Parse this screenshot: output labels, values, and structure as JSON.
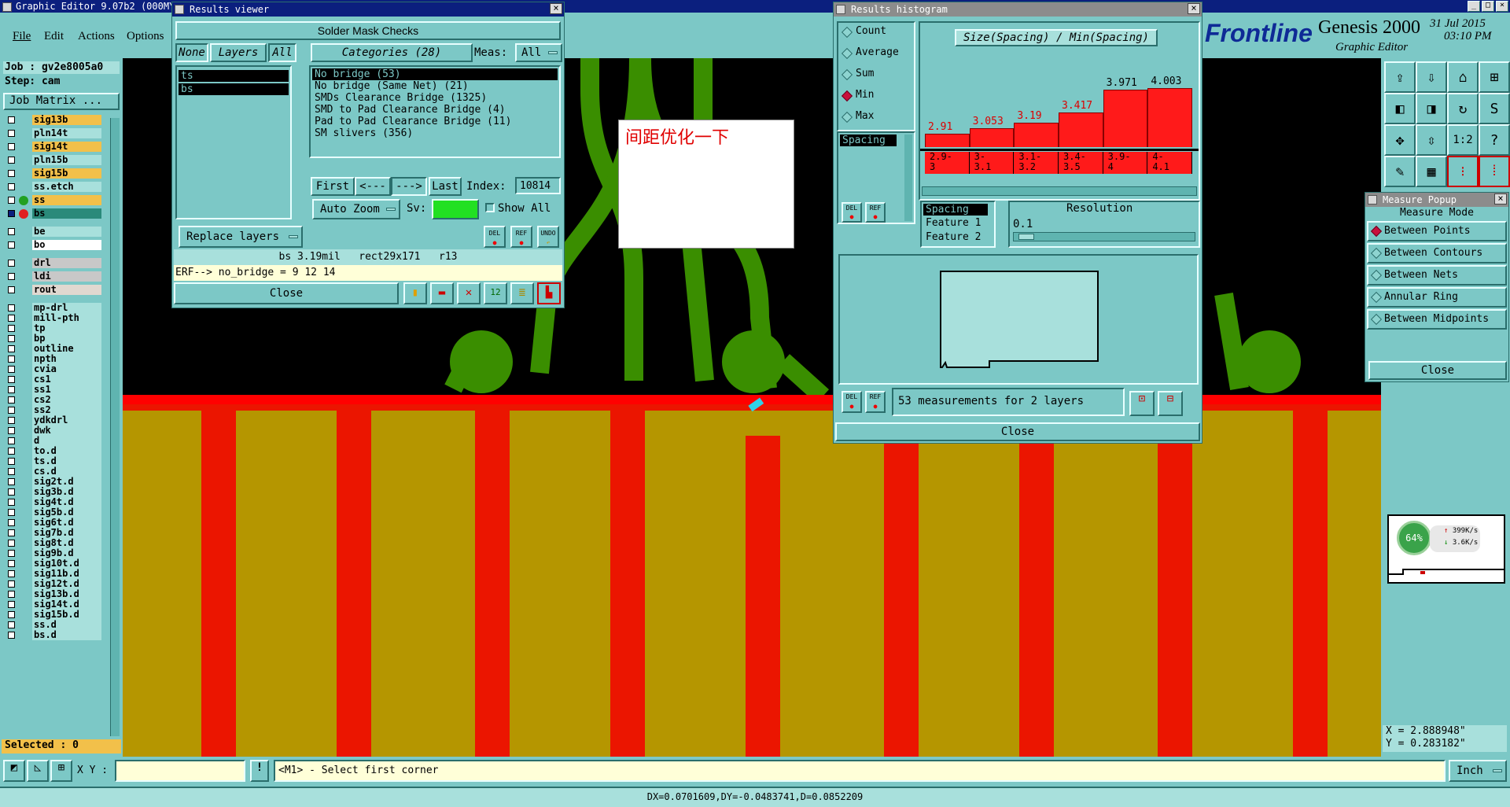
{
  "app": {
    "title": "Graphic Editor 9.07b2 (000MY",
    "window_buttons": [
      "_",
      "□",
      "×"
    ]
  },
  "menu": [
    "File",
    "Edit",
    "Actions",
    "Options"
  ],
  "brand": {
    "logo": "Frontline",
    "product": "Genesis 2000",
    "subtitle": "Graphic Editor",
    "date": "31 Jul 2015",
    "time": "03:10 PM"
  },
  "job": {
    "job": "Job : gv2e8005a0",
    "step": "Step: cam",
    "matrix_button": "Job Matrix ..."
  },
  "layers": [
    {
      "name": "sig13b",
      "bg": "#f2c04a"
    },
    {
      "name": "pln14t",
      "bg": "#a8e0dc"
    },
    {
      "name": "sig14t",
      "bg": "#f2c04a"
    },
    {
      "name": "pln15b",
      "bg": "#a8e0dc"
    },
    {
      "name": "sig15b",
      "bg": "#f2c04a"
    },
    {
      "name": "ss.etch",
      "bg": "#a8e0dc"
    },
    {
      "name": "ss",
      "bg": "#f2c04a",
      "dot": "#22a022"
    },
    {
      "name": "bs",
      "bg": "#2a8a7a",
      "dot": "#e02020",
      "sel": true
    },
    {
      "name": "be",
      "bg": "#a8e0dc"
    },
    {
      "name": "bo",
      "bg": "#ffffff"
    },
    {
      "name": "drl",
      "bg": "#c8c8c8"
    },
    {
      "name": "ldi",
      "bg": "#c8c8c8"
    },
    {
      "name": "rout",
      "bg": "#e0d8d0"
    },
    {
      "name": "mp-drl",
      "bg": "#a8e0dc"
    },
    {
      "name": "mill-pth",
      "bg": "#a8e0dc"
    },
    {
      "name": "tp",
      "bg": "#a8e0dc"
    },
    {
      "name": "bp",
      "bg": "#a8e0dc"
    },
    {
      "name": "outline",
      "bg": "#a8e0dc"
    },
    {
      "name": "npth",
      "bg": "#a8e0dc"
    },
    {
      "name": "cvia",
      "bg": "#a8e0dc"
    },
    {
      "name": "cs1",
      "bg": "#a8e0dc"
    },
    {
      "name": "ss1",
      "bg": "#a8e0dc"
    },
    {
      "name": "cs2",
      "bg": "#a8e0dc"
    },
    {
      "name": "ss2",
      "bg": "#a8e0dc"
    },
    {
      "name": "ydkdrl",
      "bg": "#a8e0dc"
    },
    {
      "name": "dwk",
      "bg": "#a8e0dc"
    },
    {
      "name": "d",
      "bg": "#a8e0dc"
    },
    {
      "name": "to.d",
      "bg": "#a8e0dc"
    },
    {
      "name": "ts.d",
      "bg": "#a8e0dc"
    },
    {
      "name": "cs.d",
      "bg": "#a8e0dc"
    },
    {
      "name": "sig2t.d",
      "bg": "#a8e0dc"
    },
    {
      "name": "sig3b.d",
      "bg": "#a8e0dc"
    },
    {
      "name": "sig4t.d",
      "bg": "#a8e0dc"
    },
    {
      "name": "sig5b.d",
      "bg": "#a8e0dc"
    },
    {
      "name": "sig6t.d",
      "bg": "#a8e0dc"
    },
    {
      "name": "sig7b.d",
      "bg": "#a8e0dc"
    },
    {
      "name": "sig8t.d",
      "bg": "#a8e0dc"
    },
    {
      "name": "sig9b.d",
      "bg": "#a8e0dc"
    },
    {
      "name": "sig10t.d",
      "bg": "#a8e0dc"
    },
    {
      "name": "sig11b.d",
      "bg": "#a8e0dc"
    },
    {
      "name": "sig12t.d",
      "bg": "#a8e0dc"
    },
    {
      "name": "sig13b.d",
      "bg": "#a8e0dc"
    },
    {
      "name": "sig14t.d",
      "bg": "#a8e0dc"
    },
    {
      "name": "sig15b.d",
      "bg": "#a8e0dc"
    },
    {
      "name": "ss.d",
      "bg": "#a8e0dc"
    },
    {
      "name": "bs.d",
      "bg": "#a8e0dc"
    }
  ],
  "selected": "Selected : 0",
  "results_viewer": {
    "title": "Results viewer",
    "heading": "Solder Mask Checks",
    "none": "None",
    "layers": "Layers",
    "all": "All",
    "categories": "Categories (28)",
    "meas_label": "Meas:",
    "meas_value": "All",
    "layer_list": [
      "ts",
      "bs"
    ],
    "cat_list": [
      "No bridge (53)",
      "No bridge (Same Net) (21)",
      "SMDs Clearance Bridge (1325)",
      "SMD to Pad Clearance Bridge (4)",
      "Pad to Pad Clearance Bridge (11)",
      "SM slivers (356)"
    ],
    "first": "First",
    "prev": "<---",
    "next": "--->",
    "last": "Last",
    "index_label": "Index:",
    "index_value": "10814",
    "auto_zoom": "Auto Zoom",
    "sv": "Sv:",
    "show_all": "Show All",
    "replace_layers": "Replace layers",
    "del": "DEL",
    "ref": "REF",
    "undo": "UNDO",
    "info": "bs 3.19mil   rect29x171   r13",
    "erf": "ERF--> no_bridge = 9 12 14",
    "close": "Close"
  },
  "note": "间距优化一下",
  "histogram": {
    "title": "Results histogram",
    "options": [
      {
        "label": "Count",
        "on": false
      },
      {
        "label": "Average",
        "on": false
      },
      {
        "label": "Sum",
        "on": false
      },
      {
        "label": "Min",
        "on": true
      },
      {
        "label": "Max",
        "on": false
      }
    ],
    "chart_title": "Size(Spacing) / Min(Spacing)",
    "list_item": "Spacing",
    "bars": [
      {
        "label": "2.91",
        "value": 2.91,
        "bin": "2.9-\n3",
        "red": true
      },
      {
        "label": "3.053",
        "value": 3.053,
        "bin": "3-\n3.1",
        "red": true
      },
      {
        "label": "3.19",
        "value": 3.19,
        "bin": "3.1-\n3.2",
        "red": true
      },
      {
        "label": "3.417",
        "value": 3.417,
        "bin": "3.4-\n3.5",
        "red": true
      },
      {
        "label": "3.971",
        "value": 3.971,
        "bin": "3.9-\n4",
        "red": false
      },
      {
        "label": "4.003",
        "value": 4.003,
        "bin": "4-\n4.1",
        "red": false
      }
    ],
    "features": [
      "Spacing",
      "Feature 1",
      "Feature 2"
    ],
    "resolution_label": "Resolution",
    "resolution_value": "0.1",
    "del": "DEL",
    "ref": "REF",
    "status": "53 measurements for 2 layers",
    "close": "Close"
  },
  "measure": {
    "title": "Measure Popup",
    "heading": "Measure Mode",
    "modes": [
      {
        "label": "Between Points",
        "on": true
      },
      {
        "label": "Between Contours",
        "on": false
      },
      {
        "label": "Between Nets",
        "on": false
      },
      {
        "label": "Annular Ring",
        "on": false
      },
      {
        "label": "Between Midpoints",
        "on": false
      }
    ],
    "close": "Close"
  },
  "netmon": {
    "percent": "64%",
    "up": "399K/s",
    "down": "3.6K/s"
  },
  "coords": {
    "x": "X = 2.888948\"",
    "y": "Y = 0.283182\""
  },
  "bottom": {
    "xy_label": "X Y :",
    "xy_value": "",
    "prompt": "<M1> - Select first corner",
    "units": "Inch",
    "status": "DX=0.0701609,DY=-0.0483741,D=0.0852209"
  },
  "colors": {
    "pad": "#ff0000",
    "copper": "#c09800",
    "trace": "#3a8e00",
    "canvas": "#000000",
    "panel": "#7cc8c6",
    "title": "#0b1f7e"
  }
}
